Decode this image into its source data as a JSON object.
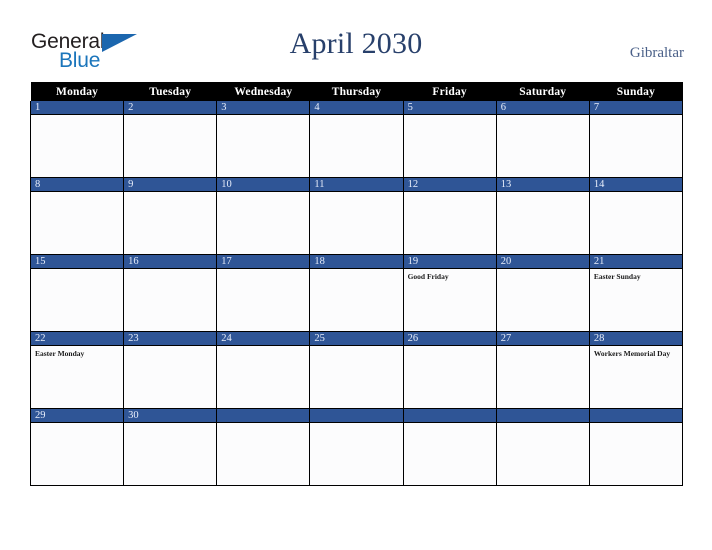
{
  "brand": {
    "name_part1": "General",
    "name_part2": "Blue",
    "primary_color": "#1b75bb",
    "text_color": "#231f20"
  },
  "header": {
    "title": "April 2030",
    "country": "Gibraltar",
    "title_color": "#28406b",
    "country_color": "#4a6088"
  },
  "calendar": {
    "month": "April",
    "year": "2030",
    "weekday_headers": [
      "Monday",
      "Tuesday",
      "Wednesday",
      "Thursday",
      "Friday",
      "Saturday",
      "Sunday"
    ],
    "header_bg": "#000000",
    "day_bar_color": "#2f5596",
    "cell_bg": "#fcfcfd",
    "weeks": [
      [
        {
          "day": "1",
          "events": []
        },
        {
          "day": "2",
          "events": []
        },
        {
          "day": "3",
          "events": []
        },
        {
          "day": "4",
          "events": []
        },
        {
          "day": "5",
          "events": []
        },
        {
          "day": "6",
          "events": []
        },
        {
          "day": "7",
          "events": []
        }
      ],
      [
        {
          "day": "8",
          "events": []
        },
        {
          "day": "9",
          "events": []
        },
        {
          "day": "10",
          "events": []
        },
        {
          "day": "11",
          "events": []
        },
        {
          "day": "12",
          "events": []
        },
        {
          "day": "13",
          "events": []
        },
        {
          "day": "14",
          "events": []
        }
      ],
      [
        {
          "day": "15",
          "events": []
        },
        {
          "day": "16",
          "events": []
        },
        {
          "day": "17",
          "events": []
        },
        {
          "day": "18",
          "events": []
        },
        {
          "day": "19",
          "events": [
            "Good Friday"
          ]
        },
        {
          "day": "20",
          "events": []
        },
        {
          "day": "21",
          "events": [
            "Easter Sunday"
          ]
        }
      ],
      [
        {
          "day": "22",
          "events": [
            "Easter Monday"
          ]
        },
        {
          "day": "23",
          "events": []
        },
        {
          "day": "24",
          "events": []
        },
        {
          "day": "25",
          "events": []
        },
        {
          "day": "26",
          "events": []
        },
        {
          "day": "27",
          "events": []
        },
        {
          "day": "28",
          "events": [
            "Workers Memorial Day"
          ]
        }
      ],
      [
        {
          "day": "29",
          "events": []
        },
        {
          "day": "30",
          "events": []
        },
        {
          "day": "",
          "events": []
        },
        {
          "day": "",
          "events": []
        },
        {
          "day": "",
          "events": []
        },
        {
          "day": "",
          "events": []
        },
        {
          "day": "",
          "events": []
        }
      ]
    ]
  }
}
